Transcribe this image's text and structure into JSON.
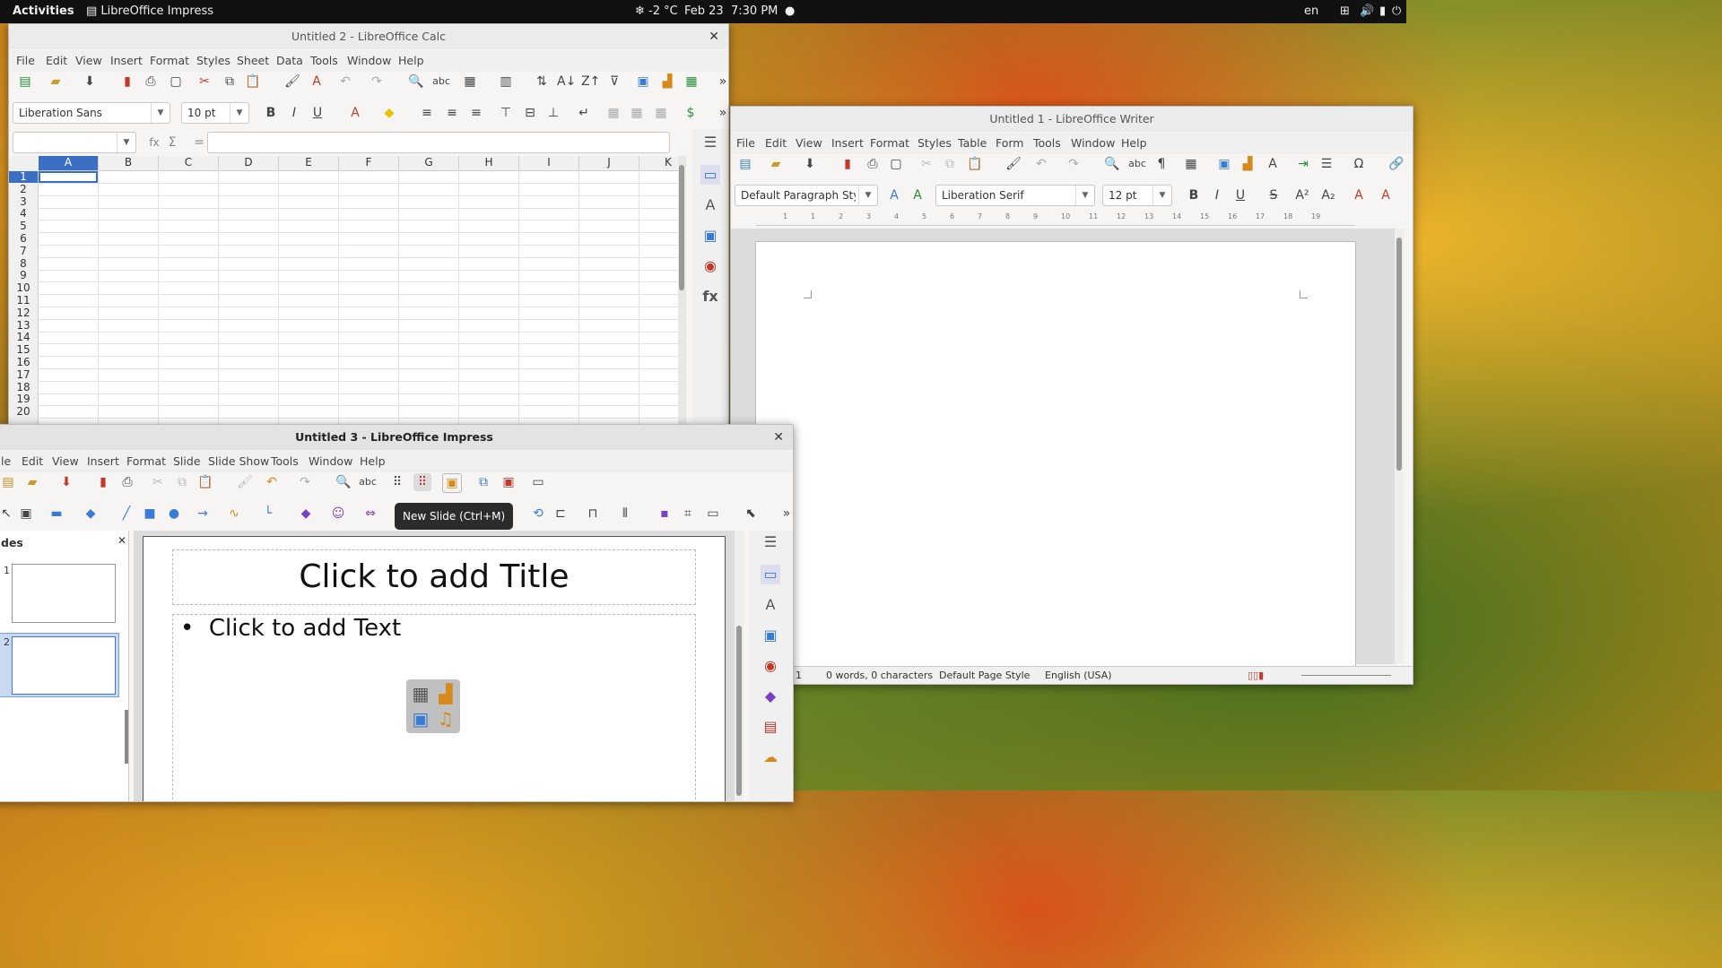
{
  "topbar": {
    "activities": "Activities",
    "app": "LibreOffice Impress",
    "weather": "-2 °C",
    "date": "Feb 23",
    "time": "7:30 PM",
    "lang": "en"
  },
  "calc": {
    "title": "Untitled 2 - LibreOffice Calc",
    "menu": [
      "File",
      "Edit",
      "View",
      "Insert",
      "Format",
      "Styles",
      "Sheet",
      "Data",
      "Tools",
      "Window",
      "Help"
    ],
    "font_name": "Liberation Sans",
    "font_size": "10 pt",
    "cols": [
      "A",
      "B",
      "C",
      "D",
      "E",
      "F",
      "G",
      "H",
      "I",
      "J",
      "K"
    ],
    "rows": [
      "1",
      "2",
      "3",
      "4",
      "5",
      "6",
      "7",
      "8",
      "9",
      "10",
      "11",
      "12",
      "13",
      "14",
      "15",
      "16",
      "17",
      "18",
      "19",
      "20"
    ],
    "fx": "fx",
    "sigma": "Σ",
    "equals": "="
  },
  "writer": {
    "title": "Untitled 1 - LibreOffice Writer",
    "menu": [
      "File",
      "Edit",
      "View",
      "Insert",
      "Format",
      "Styles",
      "Table",
      "Form",
      "Tools",
      "Window",
      "Help"
    ],
    "para_style": "Default Paragraph Style",
    "font_name": "Liberation Serif",
    "font_size": "12 pt",
    "ruler": [
      "1",
      "1",
      "2",
      "3",
      "4",
      "5",
      "6",
      "7",
      "8",
      "9",
      "10",
      "11",
      "12",
      "13",
      "14",
      "15",
      "16",
      "17",
      "18",
      "19"
    ],
    "status": {
      "page": "1",
      "words": "0 words, 0 characters",
      "page_style": "Default Page Style",
      "language": "English (USA)"
    }
  },
  "impress": {
    "title": "Untitled 3 - LibreOffice Impress",
    "menu": [
      "le",
      "Edit",
      "View",
      "Insert",
      "Format",
      "Slide",
      "Slide Show",
      "Tools",
      "Window",
      "Help"
    ],
    "slides_panel_title": "des",
    "slides": [
      "1",
      "2"
    ],
    "title_placeholder": "Click to add Title",
    "text_placeholder": "Click to add Text",
    "tooltip": "New Slide (Ctrl+M)"
  }
}
